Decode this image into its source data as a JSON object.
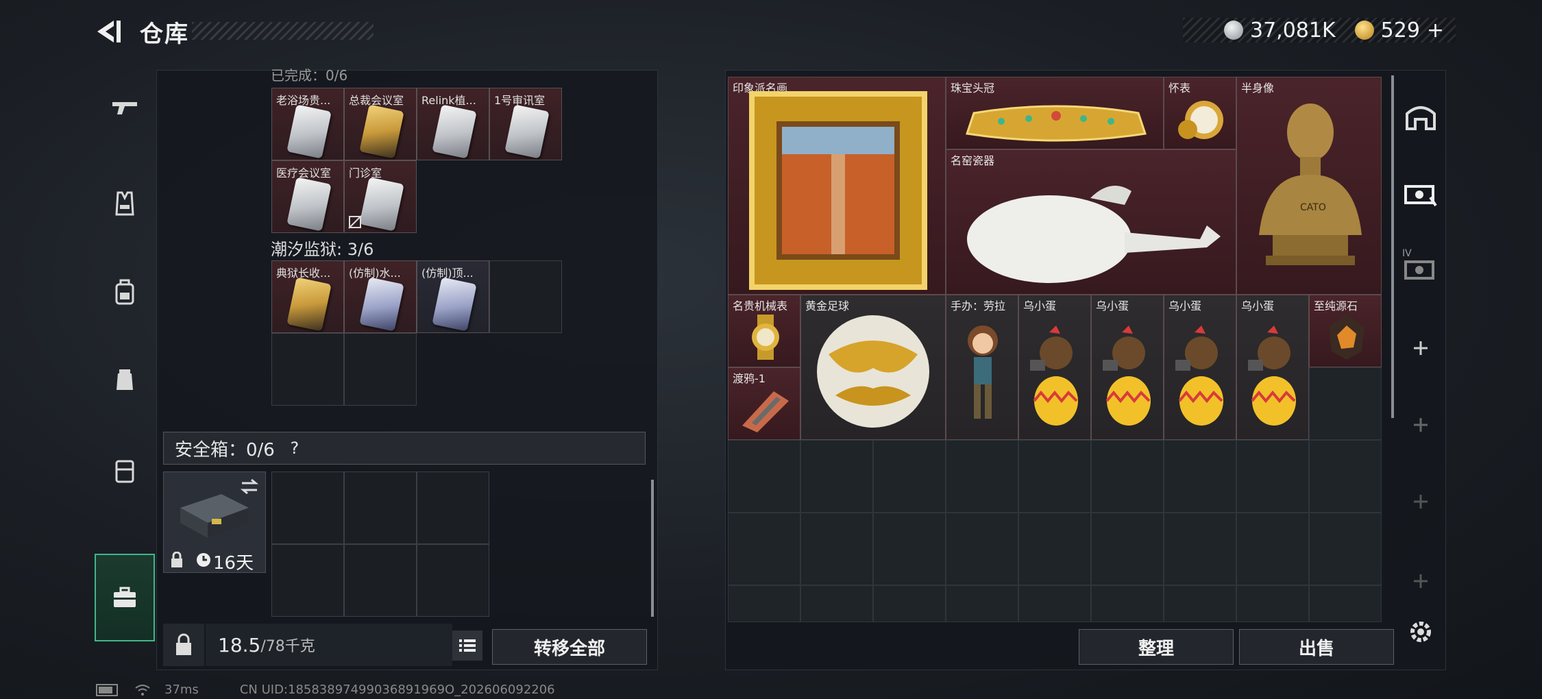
{
  "header": {
    "title": "仓库",
    "currency_silver": "37,081K",
    "currency_gold": "529",
    "gold_plus": "+"
  },
  "left_panel": {
    "section1_label": "已完成：0/6",
    "section2_label": "潮汐监狱: 3/6",
    "cards_row1": [
      "老浴场贵...",
      "总裁会议室",
      "Relink植...",
      "1号审讯室"
    ],
    "cards_row2": [
      "医疗会议室",
      "门诊室"
    ],
    "prison_cards": [
      "典狱长收...",
      "(仿制)水...",
      "(仿制)顶..."
    ],
    "safebox_label": "安全箱：0/6",
    "help": "?",
    "safebox_timer": "16天",
    "weight_value": "18.5",
    "weight_cap": "/78千克",
    "transfer_all": "转移全部"
  },
  "right_panel": {
    "items": {
      "painting": "印象派名画",
      "crown": "珠宝头冠",
      "pocket_watch": "怀表",
      "bust": "半身像",
      "porcelain": "名窑瓷器",
      "mech_watch": "名贵机械表",
      "gold_ball": "黄金足球",
      "figure": "手办：劳拉",
      "egg1": "乌小蛋",
      "egg2": "乌小蛋",
      "egg3": "乌小蛋",
      "egg4": "乌小蛋",
      "gem": "至纯源石",
      "raven": "渡鸦-1"
    },
    "bust_inscription": "CATO",
    "sort_button": "整理",
    "sell_button": "出售",
    "side_tab_iv": "IV"
  },
  "status": {
    "ping": "37ms",
    "uid": "CN UID:18583897499036891969O_202606092206"
  },
  "colors": {
    "accent_green": "#3fb78a",
    "item_red": "#4a242a"
  }
}
